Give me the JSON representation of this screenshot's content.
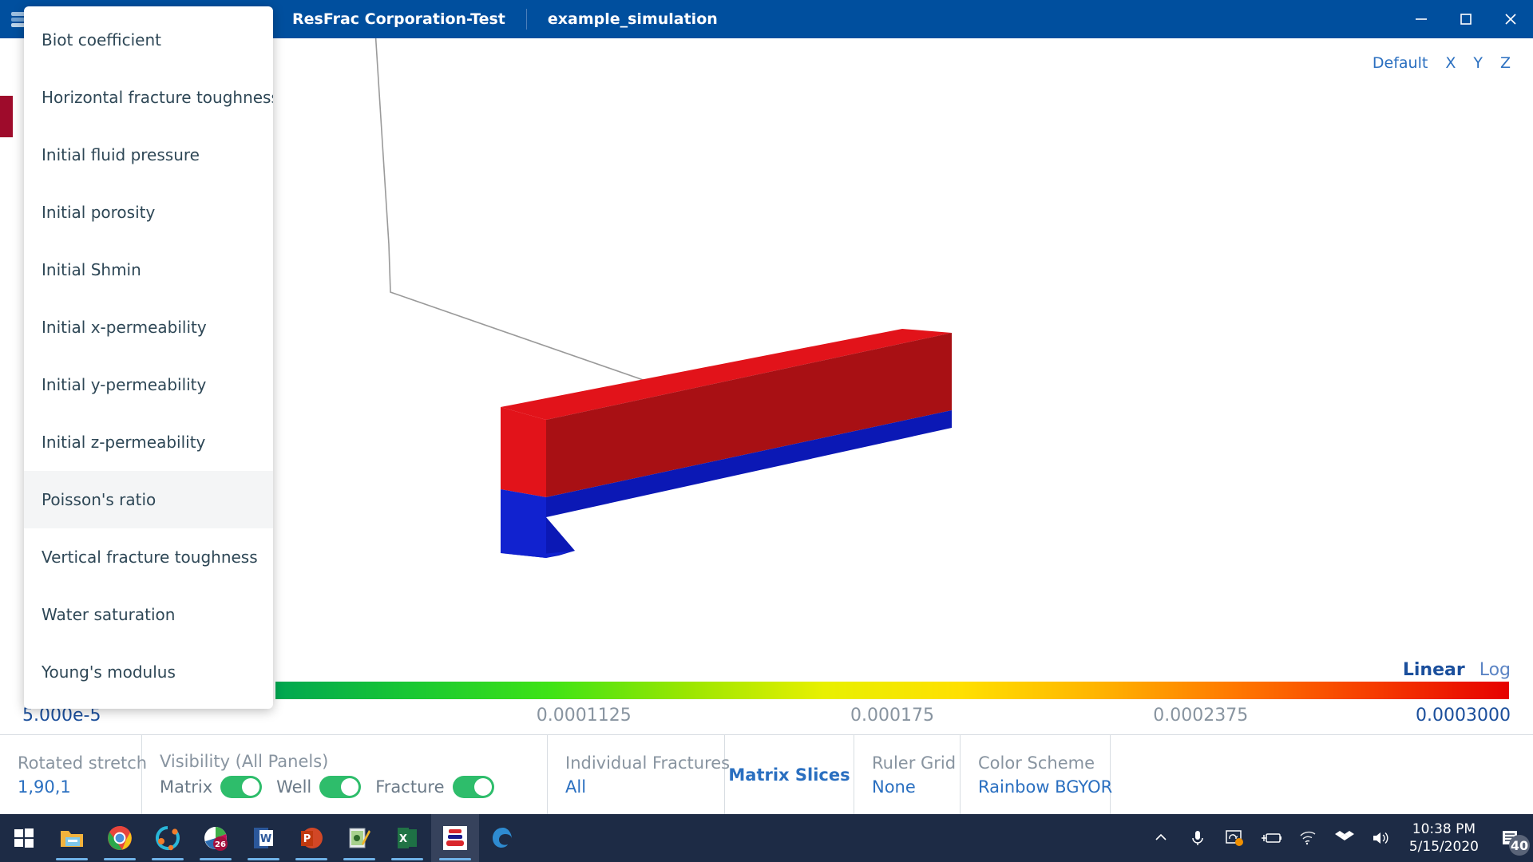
{
  "window": {
    "breadcrumbs": [
      "ResFrac Corporation-Test",
      "example_simulation"
    ],
    "controls": {
      "minimize": "minimize-button",
      "maximize": "maximize-button",
      "close": "close-button"
    }
  },
  "viewport": {
    "view_controls": [
      "Default",
      "X",
      "Y",
      "Z"
    ],
    "accent_blue": "#2a6fc0"
  },
  "dropdown": {
    "items": [
      {
        "label": "Biot coefficient",
        "selected": false
      },
      {
        "label": "Horizontal fracture toughness",
        "selected": false
      },
      {
        "label": "Initial fluid pressure",
        "selected": false
      },
      {
        "label": "Initial porosity",
        "selected": false
      },
      {
        "label": "Initial Shmin",
        "selected": false
      },
      {
        "label": "Initial x-permeability",
        "selected": false
      },
      {
        "label": "Initial y-permeability",
        "selected": false
      },
      {
        "label": "Initial z-permeability",
        "selected": false
      },
      {
        "label": "Poisson's ratio",
        "selected": true
      },
      {
        "label": "Vertical fracture toughness",
        "selected": false
      },
      {
        "label": "Water saturation",
        "selected": false
      },
      {
        "label": "Young's modulus",
        "selected": false
      }
    ]
  },
  "colorbar": {
    "scale_options": [
      {
        "label": "Linear",
        "active": true
      },
      {
        "label": "Log",
        "active": false
      }
    ],
    "ticks": [
      {
        "text": "5.000e-5",
        "pos_pct": 0,
        "edge": true
      },
      {
        "text": "0.0001125",
        "pos_pct": 25,
        "edge": false
      },
      {
        "text": "0.000175",
        "pos_pct": 50,
        "edge": false
      },
      {
        "text": "0.0002375",
        "pos_pct": 75,
        "edge": false
      },
      {
        "text": "0.0003000",
        "pos_pct": 100,
        "edge": true
      }
    ],
    "gradient_stops": [
      "#00a651",
      "#19c832",
      "#3ee316",
      "#9ae600",
      "#e8f000",
      "#ffe000",
      "#ffb400",
      "#ff7800",
      "#f63c00",
      "#e60000"
    ]
  },
  "toolbar": {
    "rotated_stretch": {
      "label": "Rotated stretch",
      "value": "1,90,1"
    },
    "visibility": {
      "label": "Visibility (All Panels)",
      "toggles": [
        {
          "name": "Matrix",
          "on": true
        },
        {
          "name": "Well",
          "on": true
        },
        {
          "name": "Fracture",
          "on": true
        }
      ]
    },
    "individual_fractures": {
      "label": "Individual Fractures",
      "value": "All"
    },
    "matrix_slices": {
      "label": "Matrix Slices"
    },
    "ruler_grid": {
      "label": "Ruler Grid",
      "value": "None"
    },
    "color_scheme": {
      "label": "Color Scheme",
      "value": "Rainbow BGYOR"
    }
  },
  "taskbar": {
    "items": [
      {
        "icon": "windows-start-icon",
        "active": false,
        "open": false
      },
      {
        "icon": "file-explorer-icon",
        "active": false,
        "open": true
      },
      {
        "icon": "google-chrome-icon",
        "active": false,
        "open": true
      },
      {
        "icon": "teal-app-icon",
        "active": false,
        "open": true
      },
      {
        "icon": "calendar-app-icon",
        "badge": "26",
        "active": false,
        "open": true
      },
      {
        "icon": "word-icon",
        "active": false,
        "open": true
      },
      {
        "icon": "powerpoint-icon",
        "active": false,
        "open": true
      },
      {
        "icon": "notepad-icon",
        "active": false,
        "open": true
      },
      {
        "icon": "excel-icon",
        "active": false,
        "open": true
      },
      {
        "icon": "resfrac-icon",
        "active": true,
        "open": true
      },
      {
        "icon": "edge-icon",
        "active": false,
        "open": false
      }
    ],
    "tray": [
      "show-hidden-icons-chevron",
      "microphone-icon",
      "screen-snip-icon",
      "battery-charging-icon",
      "wifi-icon",
      "dropbox-icon",
      "volume-icon"
    ],
    "clock": {
      "time": "10:38 PM",
      "date": "5/15/2020"
    },
    "notifications": {
      "count": "40"
    }
  }
}
